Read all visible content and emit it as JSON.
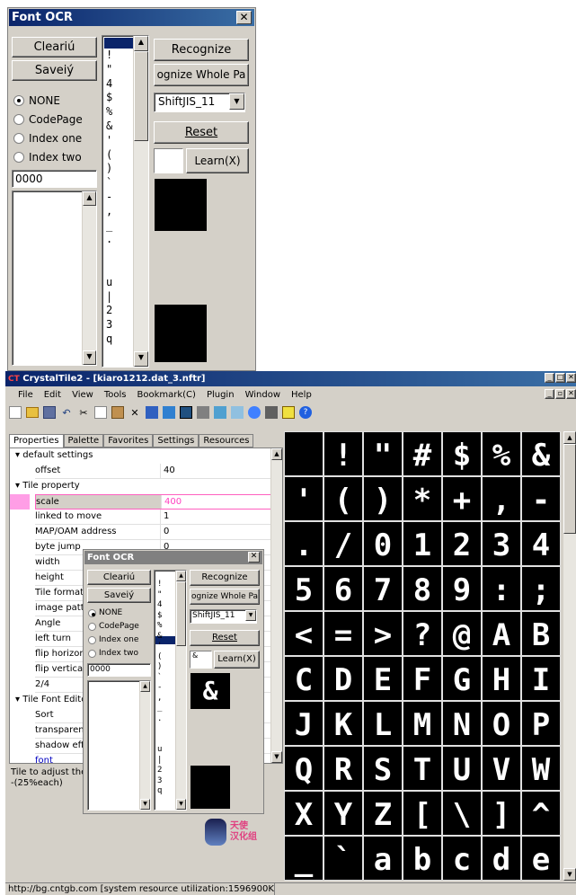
{
  "ocr_top": {
    "title": "Font OCR",
    "close": "✕",
    "clear": "Cleariú",
    "save": "Saveiý",
    "modes": [
      "NONE",
      "CodePage",
      "Index one",
      "Index two"
    ],
    "code_value": "0000",
    "recognize": "Recognize",
    "recognize_page": "ognize Whole Pa",
    "encoding": "ShiftJIS_11",
    "reset": "Reset",
    "learn": "Learn(X)",
    "glyph_list": "!\n\"\n4\n$\n%\n&\n'\n(\n)\n`\n-\n,\n_\n.\n\n\nu\n|\n2\n3\nq",
    "list_selected_color": "#0a246a"
  },
  "main": {
    "title": "CrystalTile2 - [kiaro1212.dat_3.nftr]",
    "menu": [
      "File",
      "Edit",
      "View",
      "Tools",
      "Bookmark(C)",
      "Plugin",
      "Window",
      "Help"
    ],
    "tabs": [
      "Properties",
      "Palette",
      "Favorites",
      "Settings",
      "Resources"
    ],
    "categories": [
      "default settings",
      "Tile property",
      "Tile Font Edito"
    ],
    "rows": [
      {
        "k": "offset",
        "v": "40"
      },
      {
        "k": "scale",
        "v": "400"
      },
      {
        "k": "linked to move",
        "v": "1"
      },
      {
        "k": "MAP/OAM address",
        "v": "0"
      },
      {
        "k": "byte jump",
        "v": "0"
      },
      {
        "k": "width",
        "v": ""
      },
      {
        "k": "height",
        "v": ""
      },
      {
        "k": "Tile format",
        "v": ""
      },
      {
        "k": "image pattern",
        "v": ""
      },
      {
        "k": "Angle",
        "v": ""
      },
      {
        "k": "left turn",
        "v": ""
      },
      {
        "k": "flip horizontal",
        "v": ""
      },
      {
        "k": "flip vertical",
        "v": ""
      },
      {
        "k": "2/4",
        "v": ""
      },
      {
        "k": "Sort",
        "v": ""
      },
      {
        "k": "transparency",
        "v": ""
      },
      {
        "k": "shadow effect",
        "v": ""
      },
      {
        "k": "font",
        "v": ""
      }
    ],
    "hint": "Tile to adjust the\n-(25%each)",
    "status": "http://bg.cntgb.com [system resource utilization:1596900Kb]",
    "logo_text": "天使\n汉化组",
    "tiles": [
      [
        "",
        "!",
        "\"",
        "#",
        "$",
        "%",
        "&"
      ],
      [
        "'",
        "(",
        ")",
        "*",
        "+",
        ",",
        "-"
      ],
      [
        ".",
        "/",
        "0",
        "1",
        "2",
        "3",
        "4"
      ],
      [
        "5",
        "6",
        "7",
        "8",
        "9",
        ":",
        ";"
      ],
      [
        "<",
        "=",
        ">",
        "?",
        "@",
        "A",
        "B"
      ],
      [
        "C",
        "D",
        "E",
        "F",
        "G",
        "H",
        "I"
      ],
      [
        "J",
        "K",
        "L",
        "M",
        "N",
        "O",
        "P"
      ],
      [
        "Q",
        "R",
        "S",
        "T",
        "U",
        "V",
        "W"
      ],
      [
        "X",
        "Y",
        "Z",
        "[",
        "\\",
        "]",
        "^"
      ],
      [
        "_",
        "`",
        "a",
        "b",
        "c",
        "d",
        "e"
      ]
    ]
  },
  "ocr_inner": {
    "title": "Font OCR",
    "clear": "Cleariú",
    "save": "Saveiý",
    "modes": [
      "NONE",
      "CodePage",
      "Index one",
      "Index two"
    ],
    "code_value": "0000",
    "recognize": "Recognize",
    "recognize_page": "ognize Whole Pa",
    "encoding": "ShiftJIS_11",
    "reset": "Reset",
    "learn": "Learn(X)",
    "preview_char": "&",
    "glyph_list": "!\n\"\n4\n$\n%\n&\n'\n(\n)\n`\n-\n,\n_\n.\n\n\nu\n|\n2\n3\nq"
  }
}
